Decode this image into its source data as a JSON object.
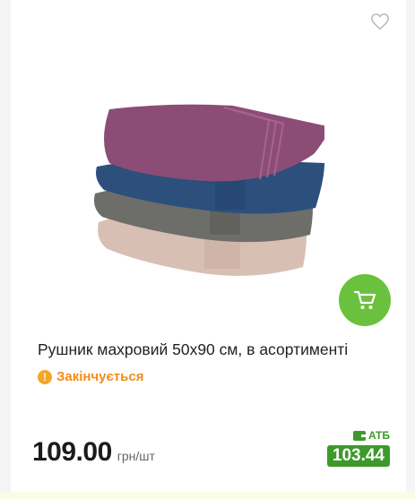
{
  "product": {
    "title": "Рушник махровий 50х90 см, в асортименті",
    "status": "Закінчується",
    "price": "109.00",
    "unit": "грн/шт",
    "atb_label": "АТБ",
    "atb_price": "103.44"
  },
  "icons": {
    "favorite": "heart-icon",
    "cart": "cart-icon",
    "status": "exclamation-icon",
    "atb": "wallet-icon"
  },
  "colors": {
    "accent_green": "#6ac13d",
    "atb_green": "#3c9a2a",
    "warning_orange": "#f28c1b"
  }
}
